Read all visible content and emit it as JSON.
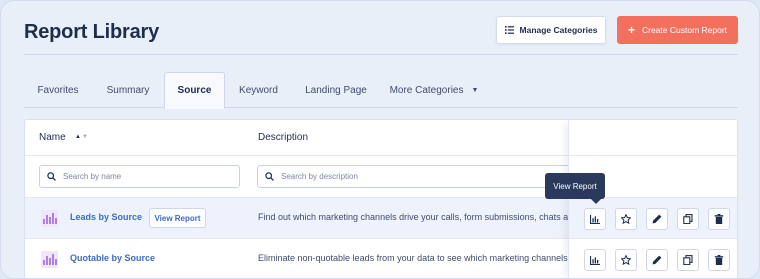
{
  "header": {
    "title": "Report Library",
    "manage_label": "Manage Categories",
    "create_label": "Create Custom Report"
  },
  "tabs": [
    {
      "label": "Favorites"
    },
    {
      "label": "Summary"
    },
    {
      "label": "Source",
      "active": true
    },
    {
      "label": "Keyword"
    },
    {
      "label": "Landing Page"
    },
    {
      "label": "More Categories"
    }
  ],
  "table": {
    "columns": {
      "name": "Name",
      "description": "Description"
    },
    "filters": {
      "name_placeholder": "Search by name",
      "description_placeholder": "Search by description"
    },
    "rows": [
      {
        "name": "Leads by Source",
        "view_label": "View Report",
        "description": "Find out which marketing channels drive your calls, form submissions, chats and",
        "highlighted": true
      },
      {
        "name": "Quotable by Source",
        "description": "Eliminate non-quotable leads from your data to see which marketing channels c",
        "highlighted": false
      }
    ]
  },
  "tooltip": "View Report",
  "colors": {
    "accent": "#f3705f",
    "link": "#3d6bc4",
    "title": "#1f2d4d",
    "tooltip_bg": "#2b3a5c",
    "row_highlight": "#edf2fc"
  },
  "icons": {
    "manage": "list-icon",
    "create": "plus-icon",
    "more": "caret-down-icon",
    "row": "bar-chart-icon",
    "actions": [
      "bar-chart-icon",
      "star-icon",
      "pencil-icon",
      "copy-icon",
      "trash-icon"
    ]
  }
}
